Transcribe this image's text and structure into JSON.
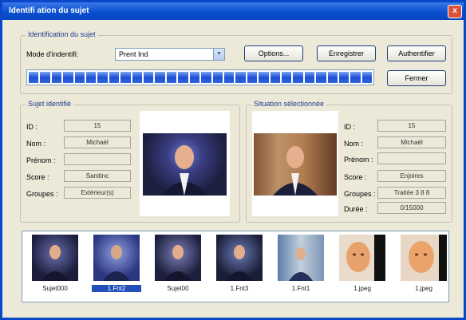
{
  "window": {
    "title": "Identifi ation du sujet",
    "close_glyph": "x"
  },
  "identification": {
    "group_title": "Identification du sujet",
    "mode_label": "Mode d'indentifi:",
    "mode_value": "Prent Ind",
    "buttons": {
      "options": "Options...",
      "enregistrer": "Enregistrer",
      "authentifier": "Authentifier",
      "fermer": "Fermer"
    },
    "progress_fraction": 1.0
  },
  "sujet_identifie": {
    "group_title": "Sujet identifié",
    "fields": [
      {
        "label": "ID :",
        "value": "15"
      },
      {
        "label": "Nom :",
        "value": "Michaël"
      },
      {
        "label": "Prénom :",
        "value": ""
      },
      {
        "label": "Score :",
        "value": "Sanitinc"
      },
      {
        "label": "Groupes :",
        "value": "Extérieur(s)"
      }
    ]
  },
  "situation_selectionnee": {
    "group_title": "Situation sélectionnée",
    "fields": [
      {
        "label": "ID :",
        "value": "15"
      },
      {
        "label": "Nom :",
        "value": "Michaël"
      },
      {
        "label": "Prénom :",
        "value": ""
      },
      {
        "label": "Score :",
        "value": "Enjoires"
      },
      {
        "label": "Groupes :",
        "value": "Traitée 3 8 8"
      },
      {
        "label": "Durée :",
        "value": "0/15000"
      }
    ]
  },
  "thumbnails": [
    {
      "label": "Sujet000",
      "selected": false
    },
    {
      "label": "1.Fnt2",
      "selected": true
    },
    {
      "label": "Sujet00",
      "selected": false
    },
    {
      "label": "1.Fnt3",
      "selected": false
    },
    {
      "label": "1.Fnt1",
      "selected": false
    },
    {
      "label": "1.jpeg",
      "selected": false
    },
    {
      "label": "1.jpeg",
      "selected": false
    }
  ],
  "colors": {
    "titlebar": "#0a4fd0",
    "progress": "#1a4fd6",
    "selection": "#2050b8"
  }
}
